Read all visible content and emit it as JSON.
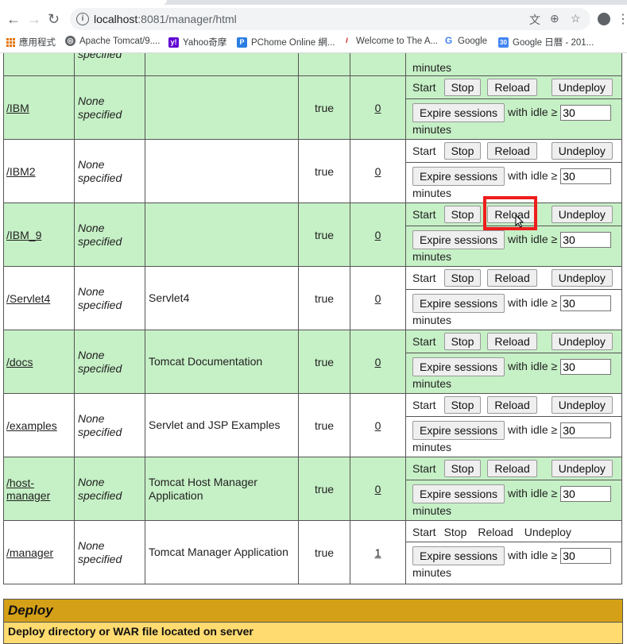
{
  "browser": {
    "url_host": "localhost",
    "url_rest": ":8081/manager/html",
    "bookmarks": [
      {
        "label": "應用程式",
        "icon": "apps-grid-icon"
      },
      {
        "label": "Apache Tomcat/9....",
        "icon": "globe-icon"
      },
      {
        "label": "Yahoo奇摩",
        "icon": "yahoo-icon"
      },
      {
        "label": "PChome Online 網...",
        "icon": "pchome-icon"
      },
      {
        "label": "Welcome to The A...",
        "icon": "feather-icon"
      },
      {
        "label": "Google",
        "icon": "google-icon"
      },
      {
        "label": "Google 日曆 - 201...",
        "icon": "calendar-icon"
      }
    ],
    "calendar_badge": "30"
  },
  "top_partial": {
    "path_text": "specified",
    "minutes": "minutes"
  },
  "commands": {
    "start": "Start",
    "stop": "Stop",
    "reload": "Reload",
    "undeploy": "Undeploy",
    "expire": "Expire sessions",
    "with_idle": "with idle ≥",
    "minutes": "minutes",
    "idle_value": "30"
  },
  "apps": [
    {
      "path": "/IBM",
      "version": "None specified",
      "display": "",
      "running": "true",
      "sessions": "0",
      "style": "g"
    },
    {
      "path": "/IBM2",
      "version": "None specified",
      "display": "",
      "running": "true",
      "sessions": "0",
      "style": "w"
    },
    {
      "path": "/IBM_9",
      "version": "None specified",
      "display": "",
      "running": "true",
      "sessions": "0",
      "style": "g"
    },
    {
      "path": "/Servlet4",
      "version": "None specified",
      "display": "Servlet4",
      "running": "true",
      "sessions": "0",
      "style": "w"
    },
    {
      "path": "/docs",
      "version": "None specified",
      "display": "Tomcat Documentation",
      "running": "true",
      "sessions": "0",
      "style": "g"
    },
    {
      "path": "/examples",
      "version": "None specified",
      "display": "Servlet and JSP Examples",
      "running": "true",
      "sessions": "0",
      "style": "w"
    },
    {
      "path": "/host-manager",
      "version": "None specified",
      "display": "Tomcat Host Manager Application",
      "running": "true",
      "sessions": "0",
      "style": "g"
    },
    {
      "path": "/manager",
      "version": "None specified",
      "display": "Tomcat Manager Application",
      "running": "true",
      "sessions": "1",
      "style": "w",
      "plain_commands": true
    }
  ],
  "deploy": {
    "title": "Deploy",
    "subtitle": "Deploy directory or WAR file located on server"
  }
}
